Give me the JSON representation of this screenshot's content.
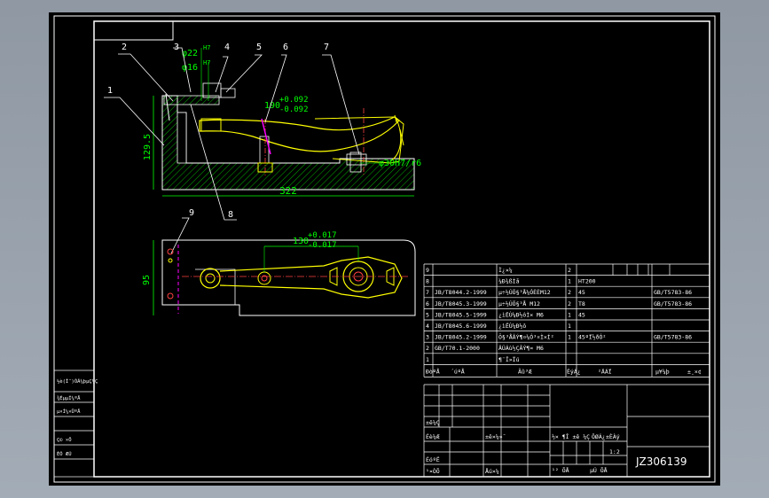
{
  "colors": {
    "background": "#000000",
    "frame": "#ffffff",
    "part": "#ffff00",
    "dimension": "#00ff00",
    "hatch": "#00cc00",
    "section": "#ff00ff",
    "hidden_line": "#ff4040"
  },
  "drawing": {
    "number": "JZ306139",
    "callouts": [
      "1",
      "2",
      "3",
      "4",
      "5",
      "6",
      "7",
      "8",
      "9"
    ],
    "dims": {
      "height": "129.5",
      "length": "322",
      "d190": "190",
      "d190_tol_up": "+0.092",
      "d190_tol_low": "-0.092",
      "d22": "φ22",
      "d22_fit": "H7",
      "d16": "φ16",
      "d16_fit": "H7",
      "fit_r6": "φ30H7/r6",
      "d130": "130",
      "d130_tol_up": "+0.017",
      "d130_tol_low": "-0.017",
      "width": "95"
    }
  },
  "bom": {
    "rows": [
      {
        "no": "9",
        "std": "",
        "name": "Ì¿×¼",
        "qty": "2",
        "mat": "",
        "note": ""
      },
      {
        "no": "8",
        "std": "",
        "name": "¼Ð¾ßÌå",
        "qty": "1",
        "mat": "HT200",
        "note": ""
      },
      {
        "no": "7",
        "std": "JB/T8044.2-1999",
        "name": "µ÷½ÚÖ§³Å¼ÓÈÈM12",
        "qty": "2",
        "mat": "45",
        "note": "GB/T5783-86"
      },
      {
        "no": "6",
        "std": "JB/T8045.3-1999",
        "name": "µ÷½ÚÖ§³Å M12",
        "qty": "2",
        "mat": "T8",
        "note": "GB/T5783-86"
      },
      {
        "no": "5",
        "std": "JB/T8045.5-1999",
        "name": "¿ìËÙ¼Ð½ôÌ× M6",
        "qty": "1",
        "mat": "45",
        "note": ""
      },
      {
        "no": "4",
        "std": "JB/T8045.6-1999",
        "name": "¿ìËÙ¼Ð½ô",
        "qty": "1",
        "mat": "",
        "note": ""
      },
      {
        "no": "3",
        "std": "JB/T8045.2-1999",
        "name": "Ö§³ÅÂÝ¶¤¼Ó³¤Ì×Í²",
        "qty": "1",
        "mat": "45ºÏ½ðÓ²",
        "note": "GB/T5783-86"
      },
      {
        "no": "2",
        "std": "GB/T70.1-2000",
        "name": "ÄÚÁù½ÇÂÝ¶¤ M6",
        "qty": "",
        "mat": "",
        "note": ""
      },
      {
        "no": "1",
        "std": "",
        "name": "¶¨Î»Ïú",
        "qty": "",
        "mat": "",
        "note": ""
      }
    ],
    "header": {
      "no": "ÐòºÅ",
      "code": "´úºÅ",
      "name": "Ãû³Æ",
      "qty": "ÊýÁ¿",
      "mat": "²ÄÁÏ",
      "weight": "µ¥¼þ",
      "note": "±¸×¢"
    }
  },
  "title_block": {
    "rows": [
      "±ê¼Ç",
      "Éè¼Æ",
      "ÉóºË",
      "¹¤ÒÕ"
    ],
    "mid": [
      "±ê×¼»¯",
      "Åú×¼"
    ],
    "stage": "½× ¶Î ±ê ¼Ç",
    "weight": "ÖØÁ¿",
    "scale": "±ÈÀý",
    "scale_value": "1:2",
    "sheets": "¹²   ÕÅ",
    "sheet_no": "µÚ   ÕÅ",
    "drawing_no": "JZ306139"
  },
  "left_strip": [
    "½è(Í¨)ÓÃ¼þµÇ¼Ç",
    "¾ÉµµÍ¼ºÅ",
    "µ×Í¼×ÜºÅ",
    "Ç©  ×Ö",
    "ÈÕ  ÆÚ"
  ]
}
